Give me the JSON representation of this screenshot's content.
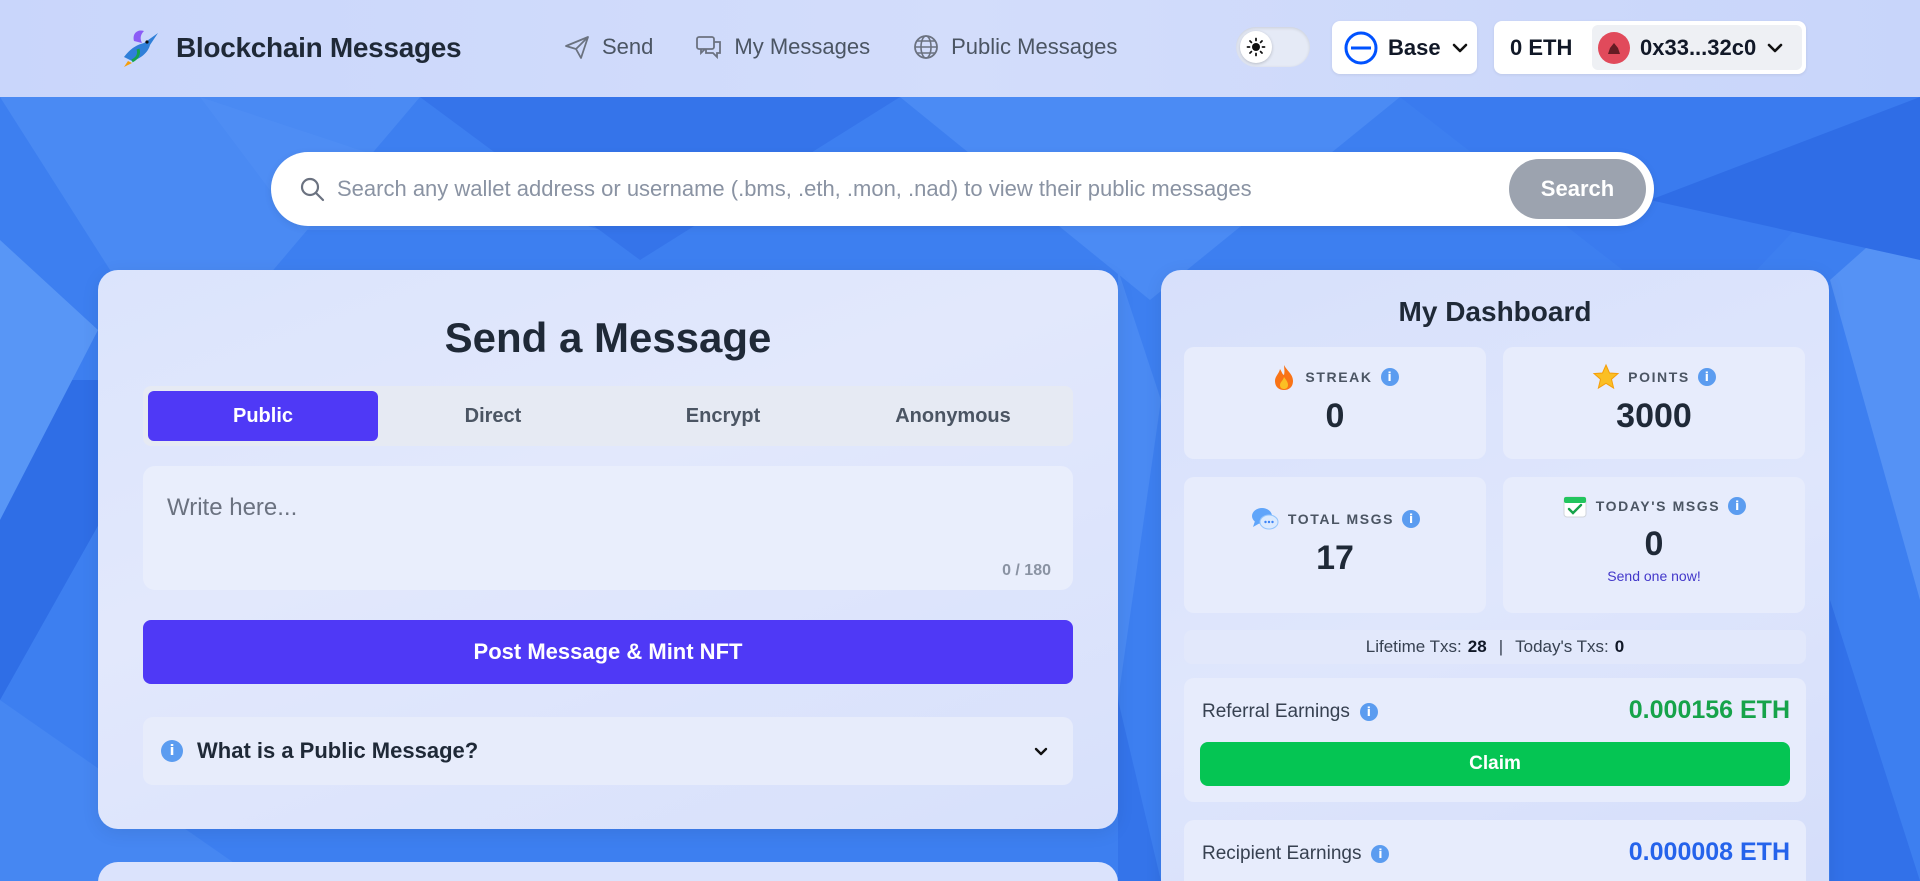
{
  "app": {
    "title": "Blockchain Messages",
    "logo_icon": "hummingbird-logo-icon"
  },
  "nav": {
    "items": [
      {
        "label": "Send",
        "icon": "paper-plane-icon"
      },
      {
        "label": "My Messages",
        "icon": "chat-bubbles-icon"
      },
      {
        "label": "Public Messages",
        "icon": "globe-icon"
      }
    ]
  },
  "header": {
    "theme_icon": "sun-icon",
    "chain": {
      "label": "Base",
      "icon": "base-chain-icon"
    },
    "wallet": {
      "balance": "0 ETH",
      "address": "0x33...32c0"
    }
  },
  "search": {
    "placeholder": "Search any wallet address or username (.bms, .eth, .mon, .nad) to view their public messages",
    "button_label": "Search"
  },
  "send": {
    "title": "Send a Message",
    "tabs": [
      {
        "label": "Public",
        "active": true
      },
      {
        "label": "Direct",
        "active": false
      },
      {
        "label": "Encrypt",
        "active": false
      },
      {
        "label": "Anonymous",
        "active": false
      }
    ],
    "compose_placeholder": "Write here...",
    "counter": "0 / 180",
    "post_button": "Post Message & Mint NFT",
    "faq_label": "What is a Public Message?"
  },
  "dashboard": {
    "title": "My Dashboard",
    "stats": [
      {
        "label": "STREAK",
        "value": "0",
        "icon": "fire-icon"
      },
      {
        "label": "POINTS",
        "value": "3000",
        "icon": "star-icon"
      },
      {
        "label": "TOTAL MSGS",
        "value": "17",
        "icon": "speech-bubbles-icon"
      },
      {
        "label": "TODAY'S MSGS",
        "value": "0",
        "sub": "Send one now!",
        "icon": "calendar-check-icon"
      }
    ],
    "lifetime": {
      "lifetime_label": "Lifetime Txs:",
      "lifetime_value": "28",
      "separator": "|",
      "today_label": "Today's Txs:",
      "today_value": "0"
    },
    "referral": {
      "label": "Referral Earnings",
      "value": "0.000156 ETH",
      "button": "Claim"
    },
    "recipient": {
      "label": "Recipient Earnings",
      "value": "0.000008 ETH"
    }
  },
  "colors": {
    "accent": "#4f39f6",
    "success": "#05c553",
    "earn_green": "#16a34a",
    "earn_blue": "#2563eb",
    "background": "#3b7cf0"
  }
}
